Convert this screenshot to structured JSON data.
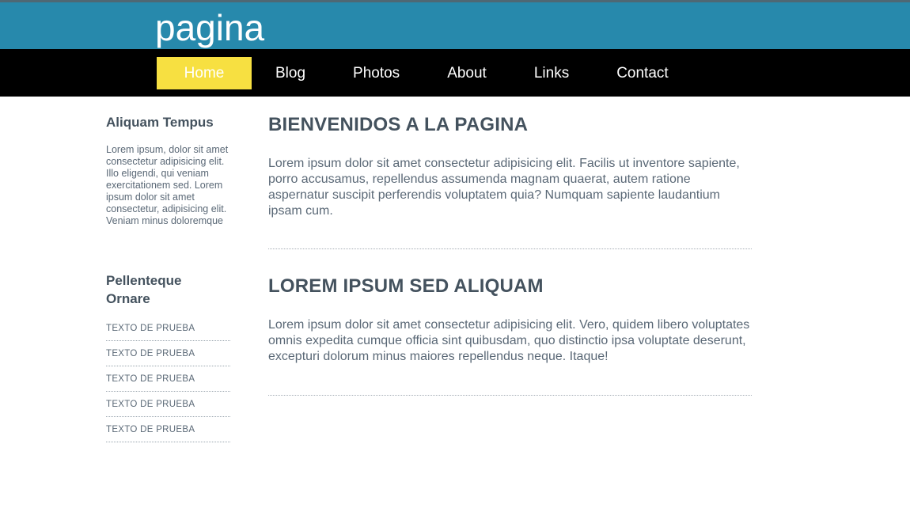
{
  "site": {
    "title": "pagina",
    "banner_color": "#2789ac",
    "nav_bg_color": "#000000",
    "active_nav_color": "#f7e041",
    "heading_color": "#44525e",
    "body_text_color": "#5a6876"
  },
  "nav": {
    "items": [
      {
        "label": "Home",
        "active": true
      },
      {
        "label": "Blog",
        "active": false
      },
      {
        "label": "Photos",
        "active": false
      },
      {
        "label": "About",
        "active": false
      },
      {
        "label": "Links",
        "active": false
      },
      {
        "label": "Contact",
        "active": false
      }
    ]
  },
  "sidebar": {
    "section_one": {
      "heading": "Aliquam Tempus",
      "text": "Lorem ipsum, dolor sit amet consectetur adipisicing elit. Illo eligendi, qui veniam exercitationem sed. Lorem ipsum dolor sit amet consectetur, adipisicing elit. Veniam minus doloremque"
    },
    "section_two": {
      "heading": "Pellenteque Ornare",
      "items": [
        "TEXTO DE PRUEBA",
        "TEXTO DE PRUEBA",
        "TEXTO DE PRUEBA",
        "TEXTO DE PRUEBA",
        "TEXTO DE PRUEBA"
      ]
    }
  },
  "main": {
    "articles": [
      {
        "heading": "BIENVENIDOS A LA PAGINA",
        "body": "Lorem ipsum dolor sit amet consectetur adipisicing elit. Facilis ut inventore sapiente, porro accusamus, repellendus assumenda magnam quaerat, autem ratione aspernatur suscipit perferendis voluptatem quia? Numquam sapiente laudantium ipsam cum."
      },
      {
        "heading": "LOREM IPSUM SED ALIQUAM",
        "body": "Lorem ipsum dolor sit amet consectetur adipisicing elit. Vero, quidem libero voluptates omnis expedita cumque officia sint quibusdam, quo distinctio ipsa voluptate deserunt, excepturi dolorum minus maiores repellendus neque. Itaque!"
      }
    ]
  }
}
